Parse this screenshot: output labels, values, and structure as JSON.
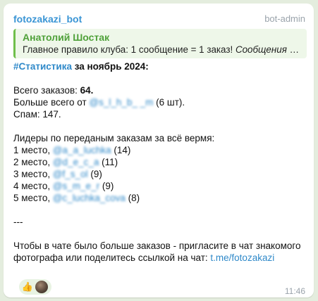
{
  "message": {
    "sender": "fotozakazi_bot",
    "badge": "bot-admin",
    "reply": {
      "author": "Анатолий Шостак",
      "text_plain": "Главное правило клуба:  1 сообщение = 1 заказ! ",
      "text_italic": "Сообщения н..."
    },
    "hashtag": "#Статистика",
    "heading_rest": " за ноябрь 2024:",
    "total_label": "Всего заказов: ",
    "total_value": "64.",
    "most_label": "Больше всего от ",
    "most_mention": "@s_l_h_b_ _m",
    "most_count": " (6 шт).",
    "spam": "Спам: 147.",
    "leaders_title": "Лидеры по переданым заказам за всё вермя:",
    "leaders": [
      {
        "place": "1 место, ",
        "mention": "@a_a_luchka",
        "count": " (14)"
      },
      {
        "place": "2 место, ",
        "mention": "@d_e_c_a",
        "count": " (11)"
      },
      {
        "place": "3 место, ",
        "mention": "@f_s_ol",
        "count": " (9)"
      },
      {
        "place": "4 место, ",
        "mention": "@s_m_e_r",
        "count": " (9)"
      },
      {
        "place": "5 место, ",
        "mention": "@c_luchka_cova",
        "count": " (8)"
      }
    ],
    "separator": "---",
    "footer_text": "Чтобы в чате было больше заказов - пригласите в чат знакомого фотографа или поделитесь ссылкой на чат: ",
    "footer_link": "t.me/fotozakazi",
    "reaction_emoji": "👍",
    "time": "11:46"
  },
  "colors": {
    "background": "#e4edde",
    "accent_link": "#2f89c9",
    "reply_accent": "#6fbf4b"
  },
  "icons": {
    "reaction": "thumbs-up-icon",
    "reactor": "avatar"
  }
}
